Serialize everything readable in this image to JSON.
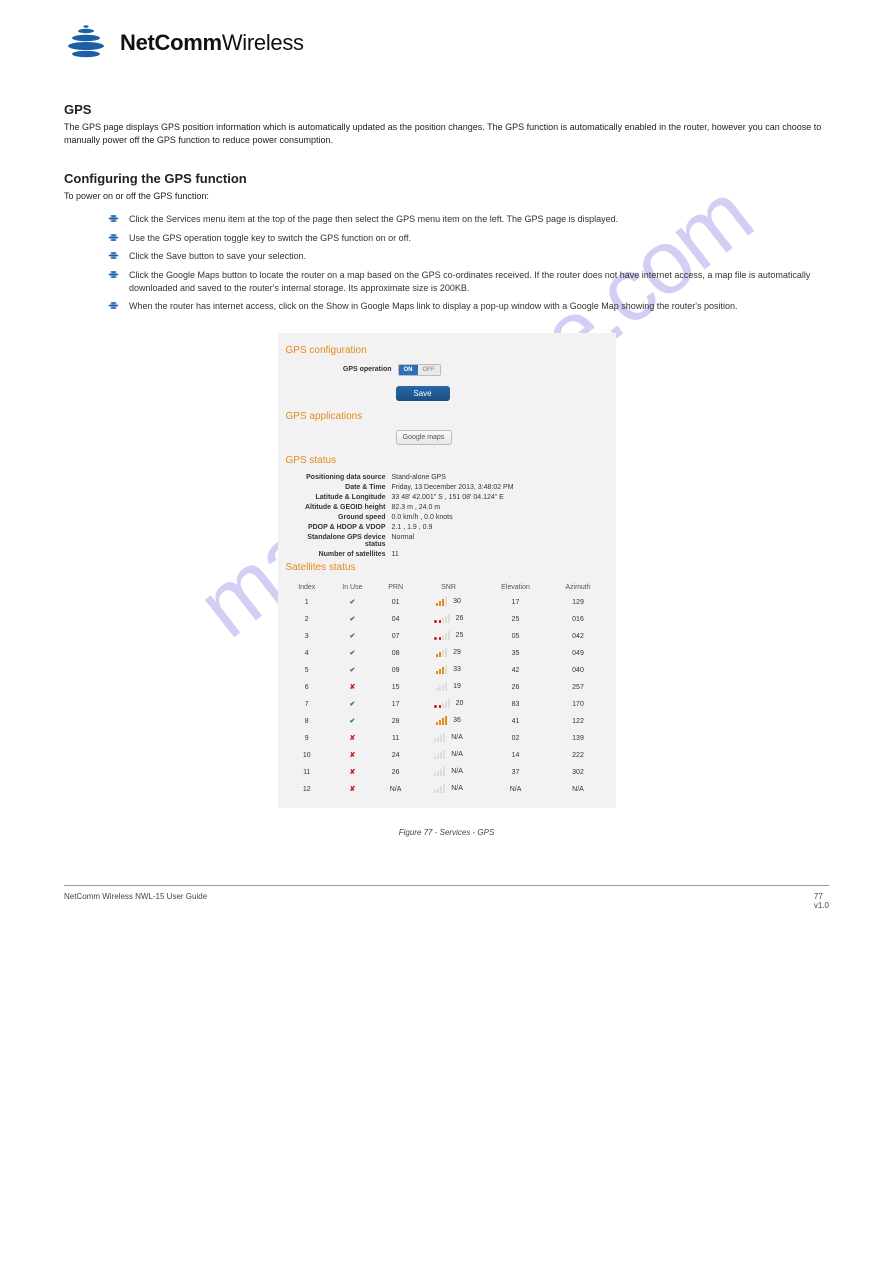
{
  "logo": {
    "bold": "NetComm",
    "light": "Wireless"
  },
  "watermark": "manualshive.com",
  "sections": {
    "gps_title": "GPS",
    "gps_intro": "The GPS page displays GPS position information which is automatically updated as the position changes. The GPS function is automatically enabled in the router, however you can choose to manually power off the GPS function to reduce power consumption.",
    "config_title": "Configuring the GPS function",
    "config_intro": "To power on or off the GPS function:",
    "bullets": [
      "Click the Services menu item at the top of the page then select the GPS menu item on the left. The GPS page is displayed.",
      "Use the GPS operation toggle key to switch the GPS function on or off.",
      "Click the Save button to save your selection.",
      "Click the Google Maps button to locate the router on a map based on the GPS co-ordinates received. If the router does not have internet access, a map file is automatically downloaded and saved to the router's internal storage. Its approximate size is 200KB.",
      "When the router has internet access, click on the Show in Google Maps link to display a pop-up window with a Google Map showing the router's position."
    ]
  },
  "panel": {
    "cfg_title": "GPS configuration",
    "cfg_label": "GPS operation",
    "toggle_on": "ON",
    "toggle_off": "OFF",
    "save": "Save",
    "apps_title": "GPS applications",
    "gmaps": "Google maps",
    "status_title": "GPS status",
    "status": [
      {
        "label": "Positioning data source",
        "value": "Stand-alone GPS"
      },
      {
        "label": "Date & Time",
        "value": "Friday, 13 December 2013, 3:48:02 PM"
      },
      {
        "label": "Latitude & Longitude",
        "value": "33 48' 42.001\" S ,  151 08' 04.124\" E"
      },
      {
        "label": "Altitude & GEOID height",
        "value": "82.3 m ,  24.0 m"
      },
      {
        "label": "Ground speed",
        "value": "0.0 km/h ,  0.0 knots"
      },
      {
        "label": "PDOP & HDOP & VDOP",
        "value": "2.1 ,  1.9 ,  0.9"
      },
      {
        "label": "Standalone GPS device status",
        "value": "Normal"
      },
      {
        "label": "Number of satellites",
        "value": "11"
      }
    ],
    "sat_title": "Satellites status",
    "sat_headers": [
      "Index",
      "In Use",
      "PRN",
      "SNR",
      "Elevation",
      "Azimuth"
    ],
    "sat_rows": [
      {
        "idx": "1",
        "use": true,
        "prn": "01",
        "bars": 3,
        "snr": "30",
        "elev": "17",
        "az": "129"
      },
      {
        "idx": "2",
        "use": true,
        "prn": "04",
        "bars": 1,
        "snr": "26",
        "elev": "25",
        "az": "016"
      },
      {
        "idx": "3",
        "use": true,
        "prn": "07",
        "bars": 1,
        "snr": "25",
        "elev": "05",
        "az": "042"
      },
      {
        "idx": "4",
        "use": true,
        "prn": "08",
        "bars": 2,
        "snr": "29",
        "elev": "35",
        "az": "049"
      },
      {
        "idx": "5",
        "use": true,
        "prn": "09",
        "bars": 3,
        "snr": "33",
        "elev": "42",
        "az": "040"
      },
      {
        "idx": "6",
        "use": false,
        "prn": "15",
        "bars": 0,
        "snr": "19",
        "elev": "26",
        "az": "257"
      },
      {
        "idx": "7",
        "use": true,
        "prn": "17",
        "bars": 1,
        "snr": "20",
        "elev": "83",
        "az": "170"
      },
      {
        "idx": "8",
        "use": true,
        "prn": "28",
        "bars": 4,
        "snr": "36",
        "elev": "41",
        "az": "122"
      },
      {
        "idx": "9",
        "use": false,
        "prn": "11",
        "bars": 0,
        "snr": "N/A",
        "elev": "02",
        "az": "139"
      },
      {
        "idx": "10",
        "use": false,
        "prn": "24",
        "bars": 0,
        "snr": "N/A",
        "elev": "14",
        "az": "222"
      },
      {
        "idx": "11",
        "use": false,
        "prn": "26",
        "bars": 0,
        "snr": "N/A",
        "elev": "37",
        "az": "302"
      },
      {
        "idx": "12",
        "use": false,
        "prn": "N/A",
        "bars": 0,
        "snr": "N/A",
        "elev": "N/A",
        "az": "N/A"
      }
    ]
  },
  "caption": "Figure 77 - Services - GPS",
  "footer": {
    "left": "NetComm Wireless NWL-15 User Guide",
    "right_num": "77",
    "right_ver": "v1.0"
  }
}
